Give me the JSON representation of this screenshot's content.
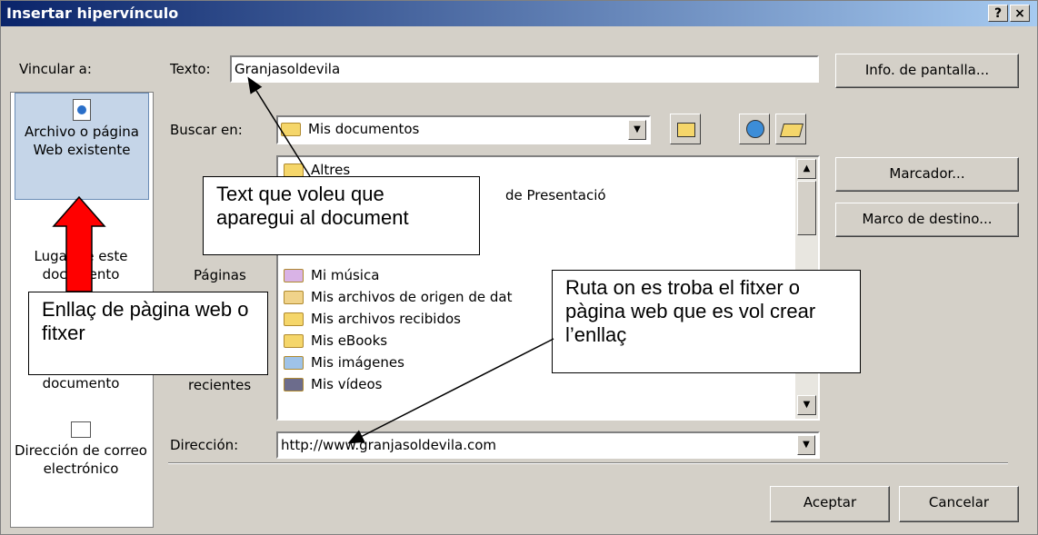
{
  "dialog": {
    "title": "Insertar hipervínculo",
    "help_glyph": "?",
    "close_glyph": "×"
  },
  "link_to": {
    "label": "Vincular a:",
    "items": [
      {
        "label": "Archivo o página Web existente"
      },
      {
        "label": "Lugar de este documento"
      },
      {
        "label": "documento"
      },
      {
        "label": "Dirección de correo electrónico"
      }
    ]
  },
  "text_field": {
    "label": "Texto:",
    "value": "Granjasoldevila"
  },
  "screen_tip_button": "Info. de pantalla...",
  "look_in": {
    "label": "Buscar en:",
    "value": "Mis documentos"
  },
  "side_tabs": [
    {
      "label": "Páginas"
    },
    {
      "label": "recientes"
    }
  ],
  "files": [
    {
      "name": "Altres"
    },
    {
      "name": "de Presentació"
    },
    {
      "name": "Mi música"
    },
    {
      "name": "Mis archivos de origen de dat"
    },
    {
      "name": "Mis archivos recibidos"
    },
    {
      "name": "Mis eBooks"
    },
    {
      "name": "Mis imágenes"
    },
    {
      "name": "Mis vídeos"
    }
  ],
  "buttons": {
    "bookmark": "Marcador...",
    "target_frame": "Marco de destino...",
    "ok": "Aceptar",
    "cancel": "Cancelar"
  },
  "address": {
    "label": "Dirección:",
    "value": "http://www.granjasoldevila.com"
  },
  "annotations": {
    "text_callout": "Text que voleu que aparegui al document",
    "link_callout": "Enllaç de pàgina web o fitxer",
    "path_callout": "Ruta on es troba el fitxer o pàgina web que es vol crear l’enllaç"
  },
  "colors": {
    "title_bar": "#0a246a",
    "dialog_bg": "#d4d0c8",
    "selected_item": "#c5d5e8",
    "arrow_fill": "#ff0000"
  }
}
